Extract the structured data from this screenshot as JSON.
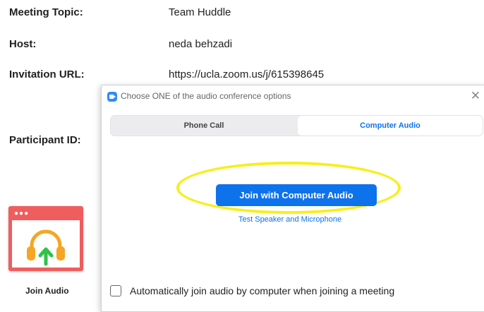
{
  "meeting_info": {
    "topic_label": "Meeting Topic:",
    "topic_value": "Team Huddle",
    "host_label": "Host:",
    "host_value": "neda behzadi",
    "url_label": "Invitation URL:",
    "url_value": "https://ucla.zoom.us/j/615398645",
    "participant_label": "Participant ID:"
  },
  "join_audio_tile": {
    "label": "Join Audio",
    "icon": "headphones-upload-icon",
    "colors": {
      "card": "#ef5d5d",
      "headphones": "#f5a623",
      "arrow": "#2ec24a"
    }
  },
  "dialog": {
    "title": "Choose ONE of the audio conference options",
    "close_icon": "close-icon",
    "tabs": [
      {
        "label": "Phone Call",
        "selected": false
      },
      {
        "label": "Computer Audio",
        "selected": true
      }
    ],
    "join_button_label": "Join with Computer Audio",
    "test_link_label": "Test Speaker and Microphone",
    "auto_join_label": "Automatically join audio by computer when joining a meeting",
    "auto_join_checked": false,
    "accent_color": "#0e72ed",
    "highlight_color": "#f7ef1a"
  }
}
